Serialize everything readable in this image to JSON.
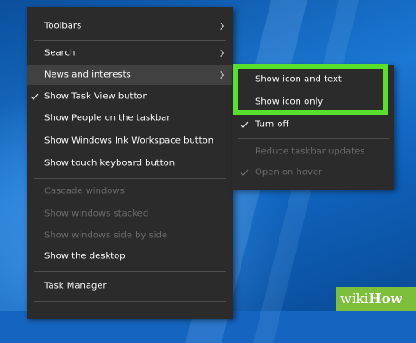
{
  "menu": {
    "items": [
      {
        "label": "Toolbars",
        "submenu": true,
        "checked": false,
        "disabled": false
      },
      {
        "label": "Search",
        "submenu": true,
        "checked": false,
        "disabled": false
      },
      {
        "label": "News and interests",
        "submenu": true,
        "checked": false,
        "disabled": false,
        "highlighted": true
      },
      {
        "label": "Show Task View button",
        "submenu": false,
        "checked": true,
        "disabled": false
      },
      {
        "label": "Show People on the taskbar",
        "submenu": false,
        "checked": false,
        "disabled": false
      },
      {
        "label": "Show Windows Ink Workspace button",
        "submenu": false,
        "checked": false,
        "disabled": false
      },
      {
        "label": "Show touch keyboard button",
        "submenu": false,
        "checked": false,
        "disabled": false
      },
      {
        "label": "Cascade windows",
        "submenu": false,
        "checked": false,
        "disabled": true
      },
      {
        "label": "Show windows stacked",
        "submenu": false,
        "checked": false,
        "disabled": true
      },
      {
        "label": "Show windows side by side",
        "submenu": false,
        "checked": false,
        "disabled": true
      },
      {
        "label": "Show the desktop",
        "submenu": false,
        "checked": false,
        "disabled": false
      },
      {
        "label": "Task Manager",
        "submenu": false,
        "checked": false,
        "disabled": false
      }
    ]
  },
  "submenu": {
    "items": [
      {
        "label": "Show icon and text",
        "checked": false,
        "disabled": false
      },
      {
        "label": "Show icon only",
        "checked": false,
        "disabled": false
      },
      {
        "label": "Turn off",
        "checked": true,
        "disabled": false
      },
      {
        "label": "Reduce taskbar updates",
        "checked": false,
        "disabled": true
      },
      {
        "label": "Open on hover",
        "checked": true,
        "disabled": true
      }
    ]
  },
  "highlight_color": "#59e02d",
  "watermark": {
    "prefix": "wiki",
    "suffix": "How"
  }
}
